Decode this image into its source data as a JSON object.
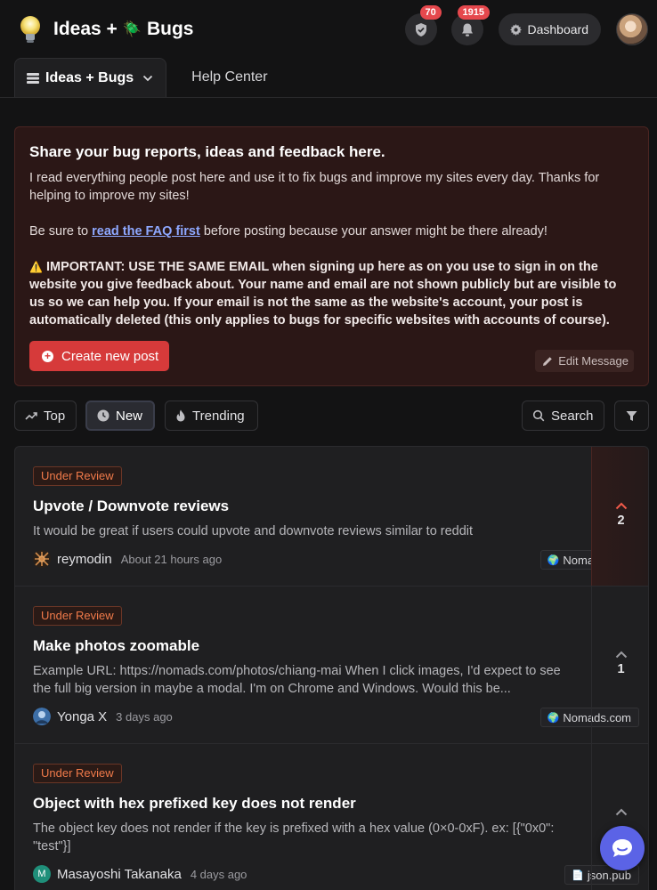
{
  "header": {
    "brand_left": "Ideas +",
    "brand_bug": "🪲",
    "brand_right": "Bugs",
    "moderation_count": "70",
    "notification_count": "1915",
    "dashboard_label": "Dashboard"
  },
  "tabs": [
    {
      "label": "Ideas + Bugs",
      "active": true
    },
    {
      "label": "Help Center",
      "active": false
    }
  ],
  "announcement": {
    "title": "Share your bug reports, ideas and feedback here.",
    "para1": "I read everything people post here and use it to fix bugs and improve my sites every day. Thanks for helping to improve my sites!",
    "para2_before": "Be sure to ",
    "para2_link": "read the FAQ first",
    "para2_after": " before posting because your answer might be there already!",
    "important_icon": "⚠️",
    "important": "IMPORTANT: USE THE SAME EMAIL when signing up here as on you use to sign in on the website you give feedback about. Your name and email are not shown publicly but are visible to us so we can help you. If your email is not the same as the website's account, your post is automatically deleted (this only applies to bugs for specific websites with accounts of course).",
    "create_label": "Create new post",
    "edit_label": "Edit Message"
  },
  "filters": {
    "top": "Top",
    "new": "New",
    "trending": "Trending",
    "search": "Search"
  },
  "posts": [
    {
      "status": "Under Review",
      "title": "Upvote / Downvote reviews",
      "desc": "It would be great if users could upvote and downvote reviews similar to reddit",
      "author": "reymodin",
      "time": "About 21 hours ago",
      "site": "Nomads.com",
      "site_icon": "🌍",
      "votes": "2",
      "upvoted": true
    },
    {
      "status": "Under Review",
      "title": "Make photos zoomable",
      "desc": "Example URL: https://nomads.com/photos/chiang-mai When I click images, I'd expect to see the full big version in maybe a modal. I'm on Chrome and Windows. Would this be...",
      "author": "Yonga X",
      "time": "3 days ago",
      "site": "Nomads.com",
      "site_icon": "🌍",
      "votes": "1",
      "upvoted": false
    },
    {
      "status": "Under Review",
      "title": "Object with hex prefixed key does not render",
      "desc": "The object key does not render if the key is prefixed with a hex value (0×0-0xF). ex: [{\"0x0\": \"test\"}]",
      "author": "Masayoshi Takanaka",
      "author_initial": "M",
      "time": "4 days ago",
      "site": "json.pub",
      "site_icon": "📄",
      "votes": "",
      "upvoted": false
    }
  ],
  "colors": {
    "background": "#131314",
    "accent_red": "#d63a3a",
    "status_orange": "#f07a4a",
    "chat": "#5b63e6"
  }
}
